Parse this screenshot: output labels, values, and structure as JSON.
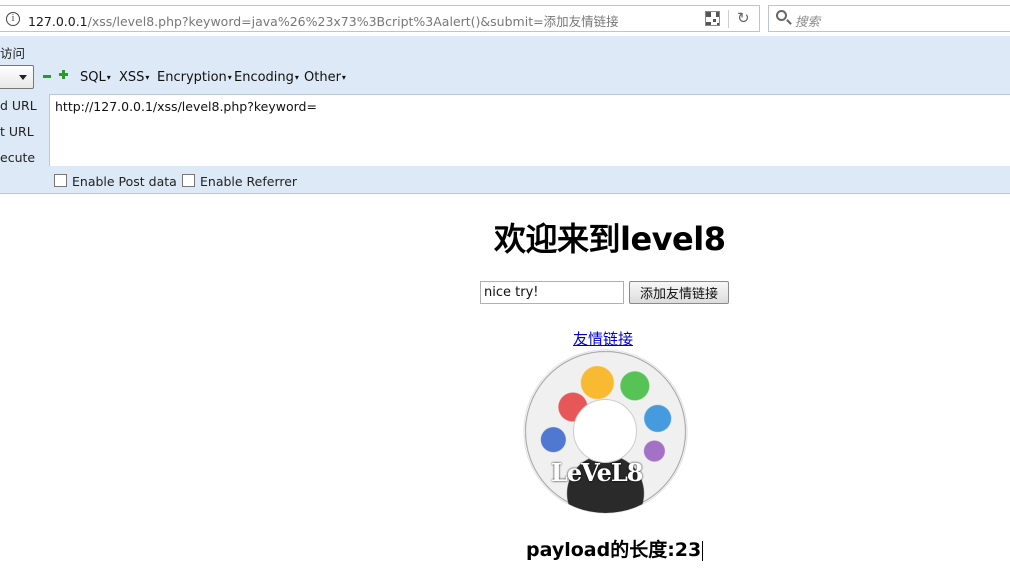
{
  "browser": {
    "url_host": "127.0.0.1",
    "url_rest": "/xss/level8.php?keyword=java%26%23x73%3Bcript%3Aalert()&submit=添加友情链接",
    "info_glyph": "i",
    "search_placeholder": "搜索",
    "reload_glyph": "↻"
  },
  "hackbar": {
    "top_label": "访问",
    "menus": [
      "SQL",
      "XSS",
      "Encryption",
      "Encoding",
      "Other"
    ],
    "side_labels": [
      "d URL",
      "t URL",
      "ecute"
    ],
    "textarea_value": "http://127.0.0.1/xss/level8.php?keyword=",
    "checkboxes": [
      "Enable Post data",
      "Enable Referrer"
    ]
  },
  "page": {
    "title": "欢迎来到level8",
    "input_value": "nice try!",
    "submit_label": "添加友情链接",
    "link_text": "友情链接",
    "image_text": "LeVeL8",
    "payload_length": "payload的长度:23"
  },
  "colors": {
    "hackbar_bg": "#dde9f6",
    "link": "#0000cc"
  },
  "icons": [
    "info-icon",
    "qr-code-icon",
    "reload-icon",
    "search-icon",
    "minus-icon",
    "plus-icon"
  ]
}
